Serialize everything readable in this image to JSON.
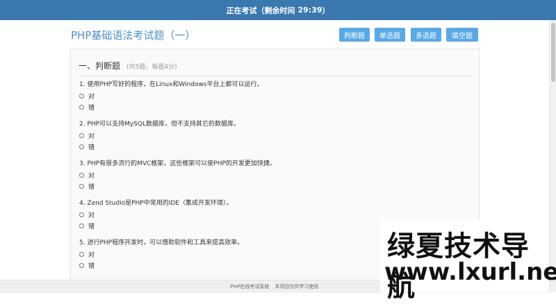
{
  "topbar": {
    "status": "正在考试",
    "remaining_prefix": "（剩余时间 ",
    "time": "29:39",
    "remaining_suffix": "）"
  },
  "page": {
    "title": "PHP基础语法考试题（一）",
    "buttons": [
      "判断题",
      "单选题",
      "多选题",
      "填空题"
    ]
  },
  "section": {
    "title": "一、判断题",
    "subtitle": "(共5题，每题4分)"
  },
  "questions": [
    {
      "text": "1. 使用PHP写好的程序，在Linux和Windows平台上都可以运行。",
      "options": [
        "对",
        "错"
      ]
    },
    {
      "text": "2. PHP可以支持MySQL数据库，但不支持其它的数据库。",
      "options": [
        "对",
        "错"
      ]
    },
    {
      "text": "3. PHP有很多流行的MVC框架，这些框架可以使PHP的开发更加快捷。",
      "options": [
        "对",
        "错"
      ]
    },
    {
      "text": "4. Zend Studio是PHP中常用的IDE（集成开发环境）。",
      "options": [
        "对",
        "错"
      ]
    },
    {
      "text": "5. 进行PHP程序开发时，可以借助软件和工具来提高效率。",
      "options": [
        "对",
        "错"
      ]
    }
  ],
  "footer": {
    "system_name": "PHP在线考试系统",
    "notice": "本项目仅供学习使用"
  },
  "watermark": {
    "line1": "绿夏技术导航",
    "line2": "www.lxurl.net"
  }
}
